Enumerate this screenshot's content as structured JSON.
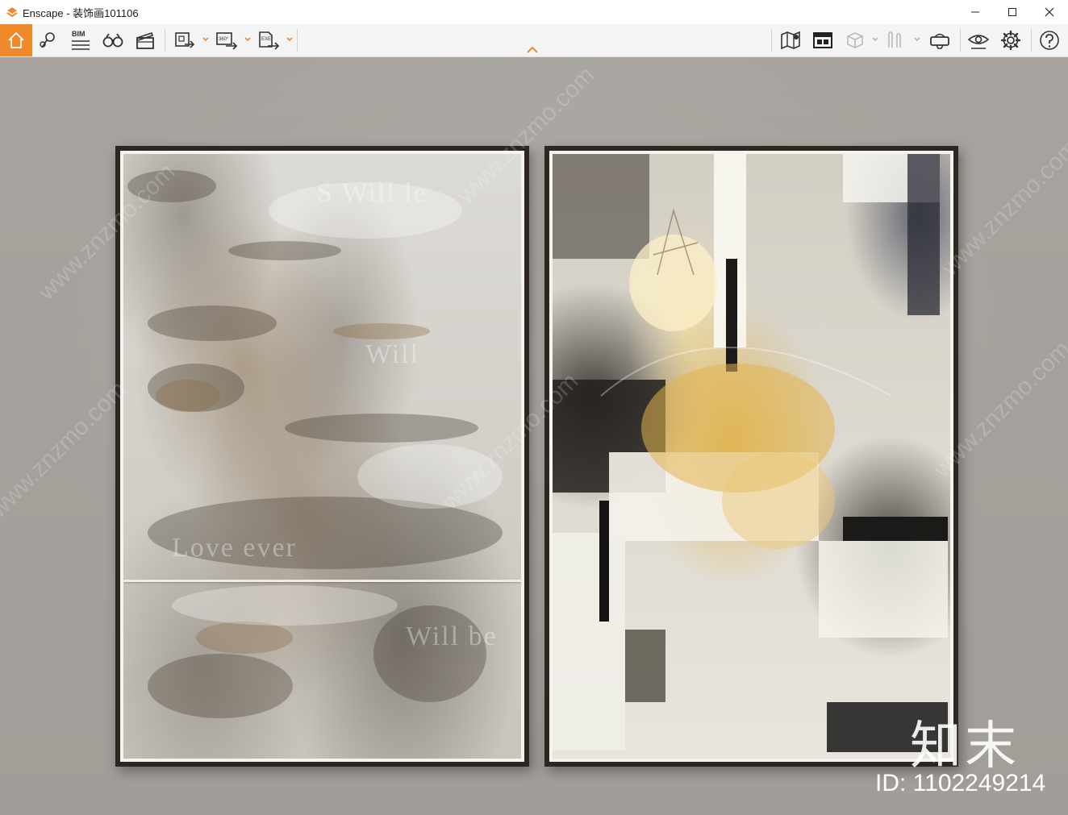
{
  "window": {
    "title": "Enscape - 装饰画101106",
    "controls": [
      "minimize",
      "maximize",
      "close"
    ]
  },
  "toolbar": {
    "accent_color": "#f0892a",
    "left_tools": [
      {
        "icon": "home-icon",
        "active": true
      },
      {
        "icon": "location-pin-icon"
      },
      {
        "icon": "bim-icon",
        "label": "BIM"
      },
      {
        "icon": "binoculars-icon"
      },
      {
        "icon": "clapperboard-icon"
      },
      {
        "icon": "screenshot-export-icon",
        "dropdown": true
      },
      {
        "icon": "panorama-360-export-icon",
        "label": "360°",
        "dropdown": true
      },
      {
        "icon": "exe-export-icon",
        "label": "EXE",
        "dropdown": true
      }
    ],
    "right_tools": [
      {
        "icon": "map-icon"
      },
      {
        "icon": "asset-library-icon"
      },
      {
        "icon": "cube-view-icon",
        "dropdown": true
      },
      {
        "icon": "walk-figures-icon",
        "dropdown": true
      },
      {
        "icon": "vr-headset-icon"
      },
      {
        "icon": "visibility-eye-icon"
      },
      {
        "icon": "settings-gear-icon"
      },
      {
        "icon": "help-icon"
      }
    ]
  },
  "viewport": {
    "wall_color": "#a9a49f",
    "frame_color": "#2e2620",
    "watermark_text": "www.znzmo.com",
    "watermark_text_cn": "知末网",
    "brand_mark": "知末",
    "brand_id": "ID: 1102249214"
  }
}
